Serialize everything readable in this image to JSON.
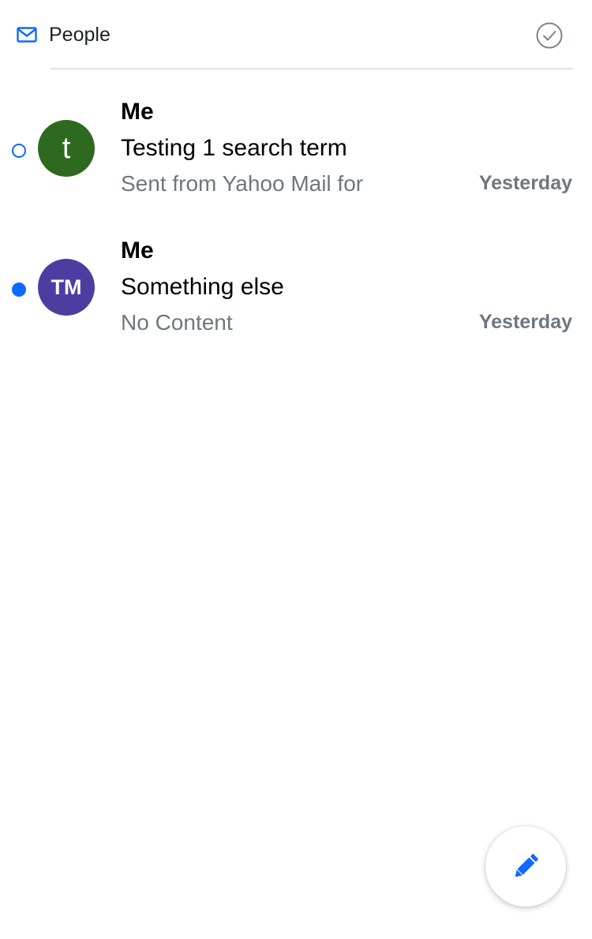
{
  "header": {
    "icon": "mail-icon",
    "title": "People",
    "select_icon": "check-circle-icon"
  },
  "colors": {
    "accent": "#0f69ff",
    "text_primary": "#000000",
    "text_secondary": "#6e7780",
    "divider": "#e0e4e9"
  },
  "messages": [
    {
      "sender": "Me",
      "subject": "Testing 1 search term",
      "snippet": "Sent from Yahoo Mail for",
      "date": "Yesterday",
      "avatar_initials": "t",
      "avatar_color": "#2d6a1f",
      "unread": false
    },
    {
      "sender": "Me",
      "subject": "Something else",
      "snippet": "No Content",
      "date": "Yesterday",
      "avatar_initials": "TM",
      "avatar_color": "#4c3ea1",
      "unread": true
    }
  ],
  "compose": {
    "icon": "pencil-icon"
  }
}
